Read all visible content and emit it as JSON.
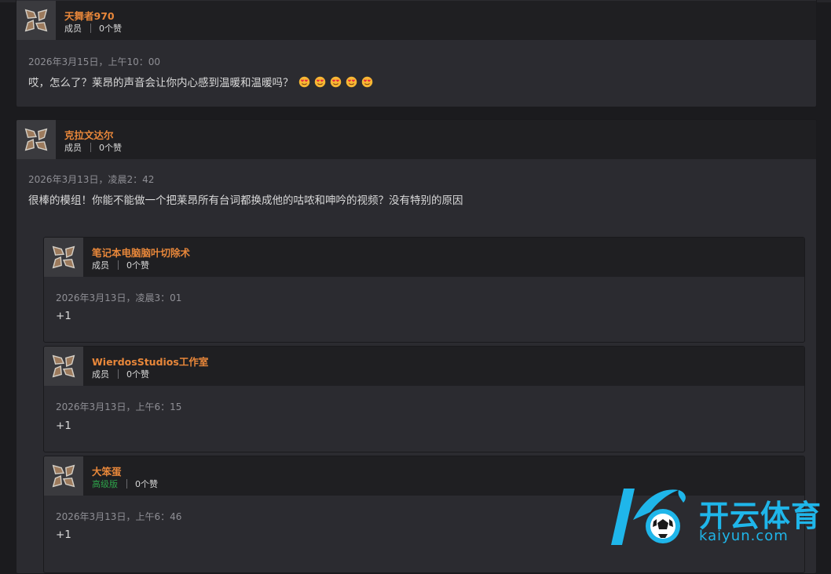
{
  "comments": [
    {
      "username": "天舞者970",
      "role": "成员",
      "likes": "0个赞",
      "timestamp": "2026年3月15日，上午10：00",
      "text": "哎，怎么了？莱昂的声音会让你内心感到温暖和温暖吗？",
      "emojis": [
        "smiling-hearts-emoji",
        "smiling-hearts-emoji",
        "smiling-hearts-emoji",
        "smiling-hearts-emoji",
        "smiling-hearts-emoji"
      ]
    },
    {
      "username": "克拉文达尔",
      "role": "成员",
      "likes": "0个赞",
      "timestamp": "2026年3月13日，凌晨2：42",
      "text": "很棒的模组！你能不能做一个把莱昂所有台词都换成他的咕哝和呻吟的视频？没有特别的原因"
    }
  ],
  "replies": [
    {
      "username": "笔记本电脑脑叶切除术",
      "role": "成员",
      "likes": "0个赞",
      "timestamp": "2026年3月13日，凌晨3：01",
      "text": "+1"
    },
    {
      "username": "WierdosStudios工作室",
      "role": "成员",
      "likes": "0个赞",
      "timestamp": "2026年3月13日，上午6：15",
      "text": "+1"
    },
    {
      "username": "大笨蛋",
      "role": "高级版",
      "likes": "0个赞",
      "timestamp": "2026年3月13日，上午6：46",
      "text": "+1"
    }
  ],
  "watermark": {
    "brand_cn": "开云体育",
    "brand_en": "kaiyun.com",
    "color": "#1fb6ea"
  },
  "colors": {
    "username": "#e8873a",
    "premium_role": "#2ea34a"
  }
}
